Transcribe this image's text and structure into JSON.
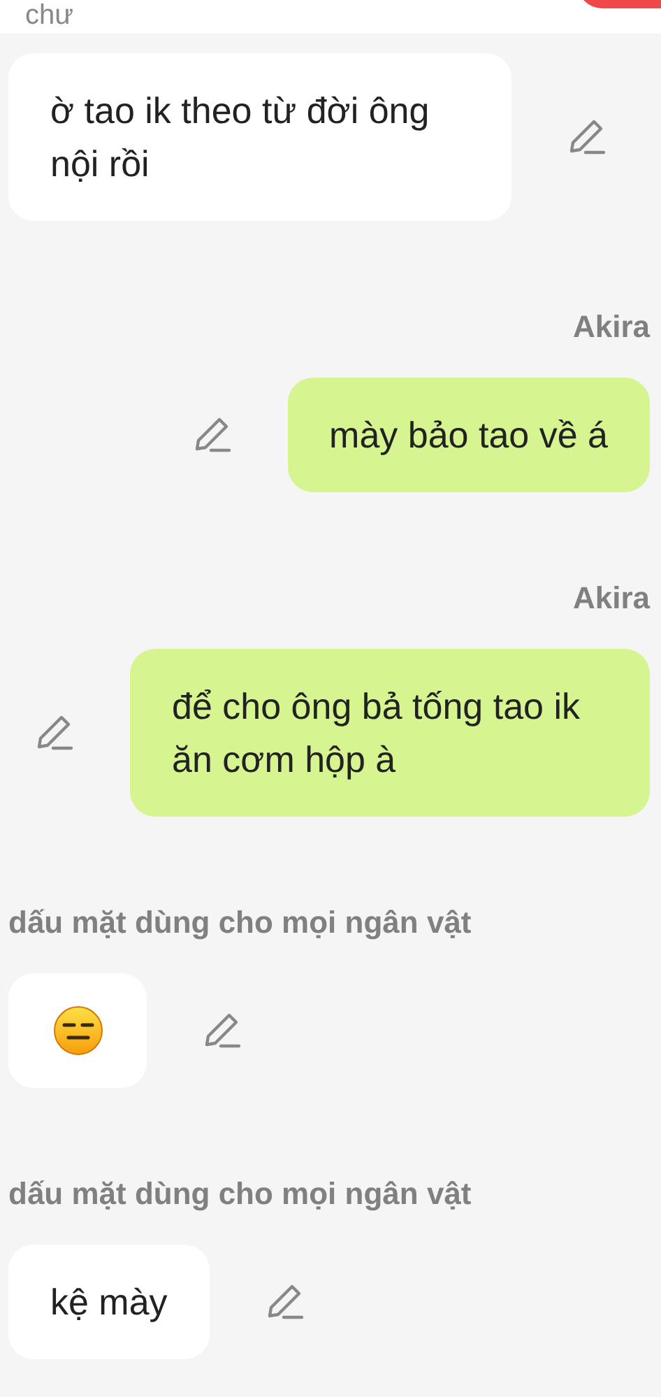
{
  "header": {
    "text": "chư"
  },
  "items": [
    {
      "kind": "incoming",
      "text": "ờ tao ik theo từ đời ông nội rồi"
    },
    {
      "kind": "sender",
      "text": "Akira"
    },
    {
      "kind": "outgoing",
      "text": "mày bảo tao về á"
    },
    {
      "kind": "sender",
      "text": "Akira"
    },
    {
      "kind": "outgoing",
      "text": "để cho ông bả tống tao ik ăn cơm hộp à"
    },
    {
      "kind": "note",
      "text": "dấu mặt dùng cho mọi ngân vật"
    },
    {
      "kind": "emoji"
    },
    {
      "kind": "note",
      "text": "dấu mặt dùng cho mọi ngân vật"
    },
    {
      "kind": "incoming",
      "text": "kệ mày"
    }
  ]
}
